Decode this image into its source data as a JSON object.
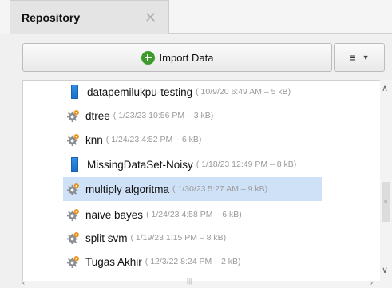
{
  "tab": {
    "title": "Repository",
    "close_glyph": "✕"
  },
  "toolbar": {
    "import_label": "Import Data",
    "import_icon": "plus-circle-icon",
    "menu_glyph": "≡",
    "caret_glyph": "▼"
  },
  "items": [
    {
      "name": "datapemilukpu-testing",
      "meta": "( 10/9/20 6:49 AM – 5 kB)",
      "icon": "data-icon",
      "selected": false
    },
    {
      "name": "dtree",
      "meta": "( 1/23/23 10:56 PM – 3 kB)",
      "icon": "process-icon",
      "selected": false
    },
    {
      "name": "knn",
      "meta": "( 1/24/23 4:52 PM – 6 kB)",
      "icon": "process-icon",
      "selected": false
    },
    {
      "name": "MissingDataSet-Noisy",
      "meta": "( 1/18/23 12:49 PM – 8 kB)",
      "icon": "data-icon",
      "selected": false
    },
    {
      "name": "multiply algoritma",
      "meta": "( 1/30/23 5:27 AM – 9 kB)",
      "icon": "process-icon",
      "selected": true
    },
    {
      "name": "naive bayes",
      "meta": "( 1/24/23 4:58 PM – 6 kB)",
      "icon": "process-icon",
      "selected": false
    },
    {
      "name": "split svm",
      "meta": "( 1/19/23 1:15 PM – 8 kB)",
      "icon": "process-icon",
      "selected": false
    },
    {
      "name": "Tugas Akhir",
      "meta": "( 12/3/22 8:24 PM – 2 kB)",
      "icon": "process-icon",
      "selected": false
    }
  ],
  "scrollbar": {
    "up_glyph": "∧",
    "down_glyph": "∨",
    "grip_glyph": "≡",
    "left_glyph": "‹",
    "right_glyph": "›",
    "hgrip_glyph": "|||"
  },
  "colors": {
    "selection": "#cfe1f7",
    "accent_green": "#3c9b2b",
    "data_blue": "#1b70c7",
    "gear_orange": "#e8951e"
  }
}
